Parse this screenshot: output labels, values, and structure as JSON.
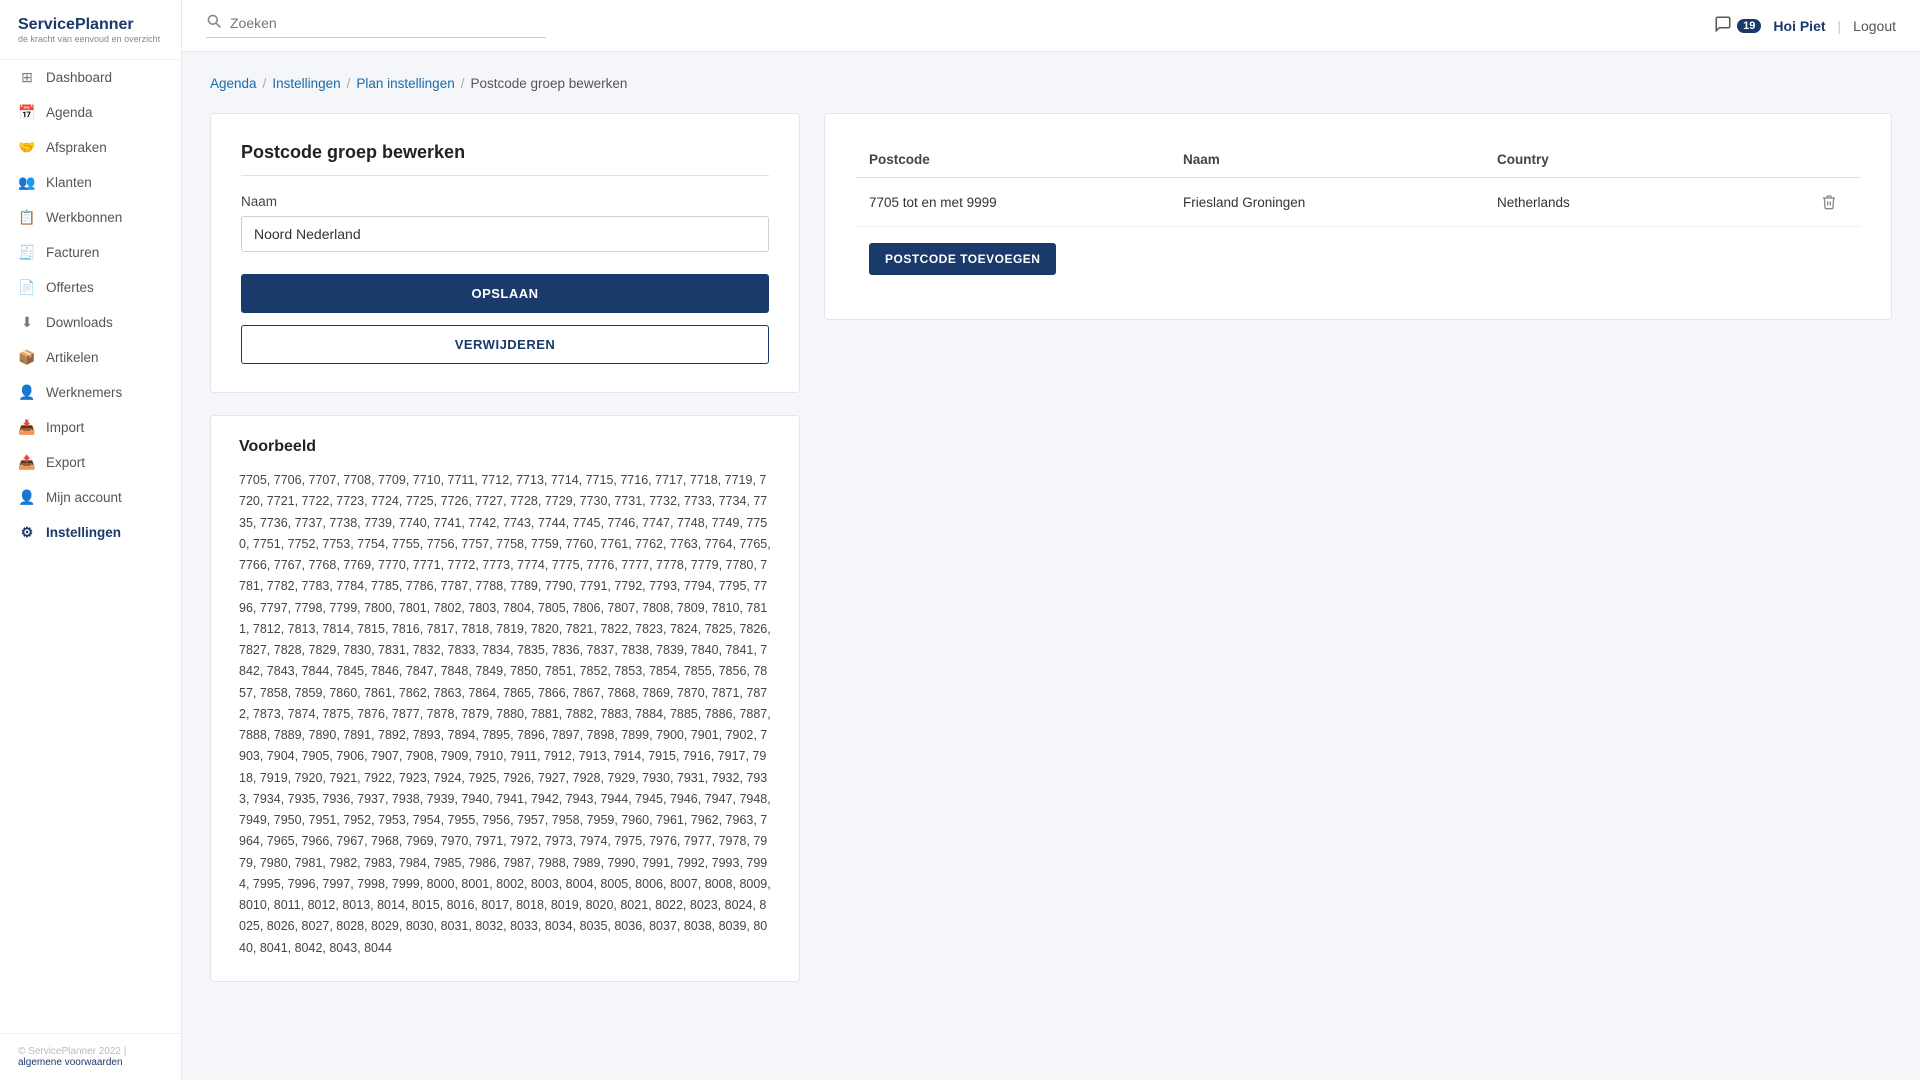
{
  "app": {
    "logo_title": "ServicePlanner",
    "logo_sub": "de kracht van eenvoud en overzicht"
  },
  "topbar": {
    "search_placeholder": "Zoeken",
    "notification_count": "19",
    "user_greeting": "Hoi Piet",
    "logout_label": "Logout"
  },
  "sidebar": {
    "items": [
      {
        "id": "dashboard",
        "label": "Dashboard",
        "icon": "⊞"
      },
      {
        "id": "agenda",
        "label": "Agenda",
        "icon": "📅"
      },
      {
        "id": "afspraken",
        "label": "Afspraken",
        "icon": "🤝"
      },
      {
        "id": "klanten",
        "label": "Klanten",
        "icon": "👥"
      },
      {
        "id": "werkbonnen",
        "label": "Werkbonnen",
        "icon": "📋"
      },
      {
        "id": "facturen",
        "label": "Facturen",
        "icon": "🧾"
      },
      {
        "id": "offertes",
        "label": "Offertes",
        "icon": "📄"
      },
      {
        "id": "downloads",
        "label": "Downloads",
        "icon": "⬇"
      },
      {
        "id": "artikelen",
        "label": "Artikelen",
        "icon": "📦"
      },
      {
        "id": "werknemers",
        "label": "Werknemers",
        "icon": "👤"
      },
      {
        "id": "import",
        "label": "Import",
        "icon": "📥"
      },
      {
        "id": "export",
        "label": "Export",
        "icon": "📤"
      },
      {
        "id": "mijn-account",
        "label": "Mijn account",
        "icon": "👤"
      },
      {
        "id": "instellingen",
        "label": "Instellingen",
        "icon": "⚙"
      }
    ]
  },
  "footer": {
    "copyright": "© ServicePlanner 2022 |",
    "link_label": "algemene voorwaarden"
  },
  "breadcrumb": {
    "items": [
      {
        "label": "Agenda",
        "link": true
      },
      {
        "label": "Instellingen",
        "link": true
      },
      {
        "label": "Plan instellingen",
        "link": true
      },
      {
        "label": "Postcode groep bewerken",
        "link": false
      }
    ]
  },
  "form": {
    "title": "Postcode groep bewerken",
    "name_label": "Naam",
    "name_value": "Noord Nederland",
    "save_label": "OPSLAAN",
    "delete_label": "VERWIJDEREN"
  },
  "postcode_table": {
    "col_postcode": "Postcode",
    "col_naam": "Naam",
    "col_country": "Country",
    "rows": [
      {
        "postcode": "7705 tot en met 9999",
        "naam": "Friesland Groningen",
        "country": "Netherlands"
      }
    ],
    "add_button": "POSTCODE TOEVOEGEN"
  },
  "example": {
    "title": "Voorbeeld",
    "content": "7705, 7706, 7707, 7708, 7709, 7710, 7711, 7712, 7713, 7714, 7715, 7716, 7717, 7718, 7719, 7720, 7721, 7722, 7723, 7724, 7725, 7726, 7727, 7728, 7729, 7730, 7731, 7732, 7733, 7734, 7735, 7736, 7737, 7738, 7739, 7740, 7741, 7742, 7743, 7744, 7745, 7746, 7747, 7748, 7749, 7750, 7751, 7752, 7753, 7754, 7755, 7756, 7757, 7758, 7759, 7760, 7761, 7762, 7763, 7764, 7765, 7766, 7767, 7768, 7769, 7770, 7771, 7772, 7773, 7774, 7775, 7776, 7777, 7778, 7779, 7780, 7781, 7782, 7783, 7784, 7785, 7786, 7787, 7788, 7789, 7790, 7791, 7792, 7793, 7794, 7795, 7796, 7797, 7798, 7799, 7800, 7801, 7802, 7803, 7804, 7805, 7806, 7807, 7808, 7809, 7810, 7811, 7812, 7813, 7814, 7815, 7816, 7817, 7818, 7819, 7820, 7821, 7822, 7823, 7824, 7825, 7826, 7827, 7828, 7829, 7830, 7831, 7832, 7833, 7834, 7835, 7836, 7837, 7838, 7839, 7840, 7841, 7842, 7843, 7844, 7845, 7846, 7847, 7848, 7849, 7850, 7851, 7852, 7853, 7854, 7855, 7856, 7857, 7858, 7859, 7860, 7861, 7862, 7863, 7864, 7865, 7866, 7867, 7868, 7869, 7870, 7871, 7872, 7873, 7874, 7875, 7876, 7877, 7878, 7879, 7880, 7881, 7882, 7883, 7884, 7885, 7886, 7887, 7888, 7889, 7890, 7891, 7892, 7893, 7894, 7895, 7896, 7897, 7898, 7899, 7900, 7901, 7902, 7903, 7904, 7905, 7906, 7907, 7908, 7909, 7910, 7911, 7912, 7913, 7914, 7915, 7916, 7917, 7918, 7919, 7920, 7921, 7922, 7923, 7924, 7925, 7926, 7927, 7928, 7929, 7930, 7931, 7932, 7933, 7934, 7935, 7936, 7937, 7938, 7939, 7940, 7941, 7942, 7943, 7944, 7945, 7946, 7947, 7948, 7949, 7950, 7951, 7952, 7953, 7954, 7955, 7956, 7957, 7958, 7959, 7960, 7961, 7962, 7963, 7964, 7965, 7966, 7967, 7968, 7969, 7970, 7971, 7972, 7973, 7974, 7975, 7976, 7977, 7978, 7979, 7980, 7981, 7982, 7983, 7984, 7985, 7986, 7987, 7988, 7989, 7990, 7991, 7992, 7993, 7994, 7995, 7996, 7997, 7998, 7999, 8000, 8001, 8002, 8003, 8004, 8005, 8006, 8007, 8008, 8009, 8010, 8011, 8012, 8013, 8014, 8015, 8016, 8017, 8018, 8019, 8020, 8021, 8022, 8023, 8024, 8025, 8026, 8027, 8028, 8029, 8030, 8031, 8032, 8033, 8034, 8035, 8036, 8037, 8038, 8039, 8040, 8041, 8042, 8043, 8044"
  }
}
